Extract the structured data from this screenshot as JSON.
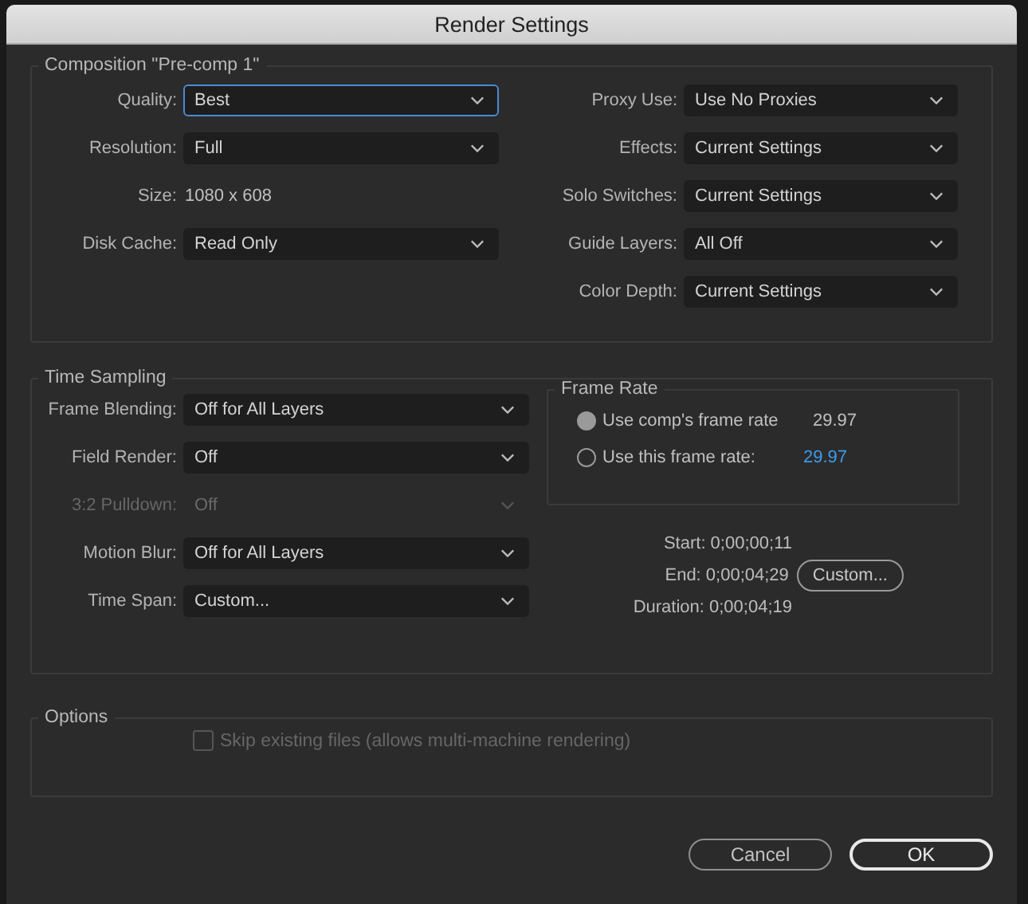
{
  "window": {
    "title": "Render Settings"
  },
  "composition": {
    "title": "Composition \"Pre-comp 1\"",
    "left_fields": [
      {
        "label": "Quality:",
        "value": "Best",
        "kind": "dropdown",
        "focused": true
      },
      {
        "label": "Resolution:",
        "value": "Full",
        "kind": "dropdown",
        "focused": false
      },
      {
        "label": "Size:",
        "value": "1080 x 608",
        "kind": "text"
      },
      {
        "label": "Disk Cache:",
        "value": "Read Only",
        "kind": "dropdown",
        "focused": false
      }
    ],
    "right_fields": [
      {
        "label": "Proxy Use:",
        "value": "Use No Proxies",
        "kind": "dropdown",
        "focused": false
      },
      {
        "label": "Effects:",
        "value": "Current Settings",
        "kind": "dropdown",
        "focused": false
      },
      {
        "label": "Solo Switches:",
        "value": "Current Settings",
        "kind": "dropdown",
        "focused": false
      },
      {
        "label": "Guide Layers:",
        "value": "All Off",
        "kind": "dropdown",
        "focused": false
      },
      {
        "label": "Color Depth:",
        "value": "Current Settings",
        "kind": "dropdown",
        "focused": false
      }
    ]
  },
  "time_sampling": {
    "title": "Time Sampling",
    "fields": [
      {
        "label": "Frame Blending:",
        "value": "Off for All Layers",
        "disabled": false
      },
      {
        "label": "Field Render:",
        "value": "Off",
        "disabled": false
      },
      {
        "label": "3:2 Pulldown:",
        "value": "Off",
        "disabled": true
      },
      {
        "label": "Motion Blur:",
        "value": "Off for All Layers",
        "disabled": false
      },
      {
        "label": "Time Span:",
        "value": "Custom...",
        "disabled": false
      }
    ],
    "frame_rate": {
      "title": "Frame Rate",
      "options": [
        {
          "label": "Use comp's frame rate",
          "value": "29.97",
          "kind": "readout",
          "selected": true
        },
        {
          "label": "Use this frame rate:",
          "value": "29.97",
          "kind": "input",
          "selected": false
        }
      ]
    },
    "span": [
      {
        "label": "Start:",
        "value": "0;00;00;11"
      },
      {
        "label": "End:",
        "value": "0;00;04;29"
      },
      {
        "label": "Duration:",
        "value": "0;00;04;19"
      }
    ],
    "custom_button": "Custom..."
  },
  "options": {
    "title": "Options",
    "checkbox": {
      "label": "Skip existing files (allows multi-machine rendering)",
      "checked": false,
      "disabled": true
    }
  },
  "buttons": [
    {
      "label": "Cancel",
      "kind": "secondary"
    },
    {
      "label": "OK",
      "kind": "default"
    }
  ]
}
